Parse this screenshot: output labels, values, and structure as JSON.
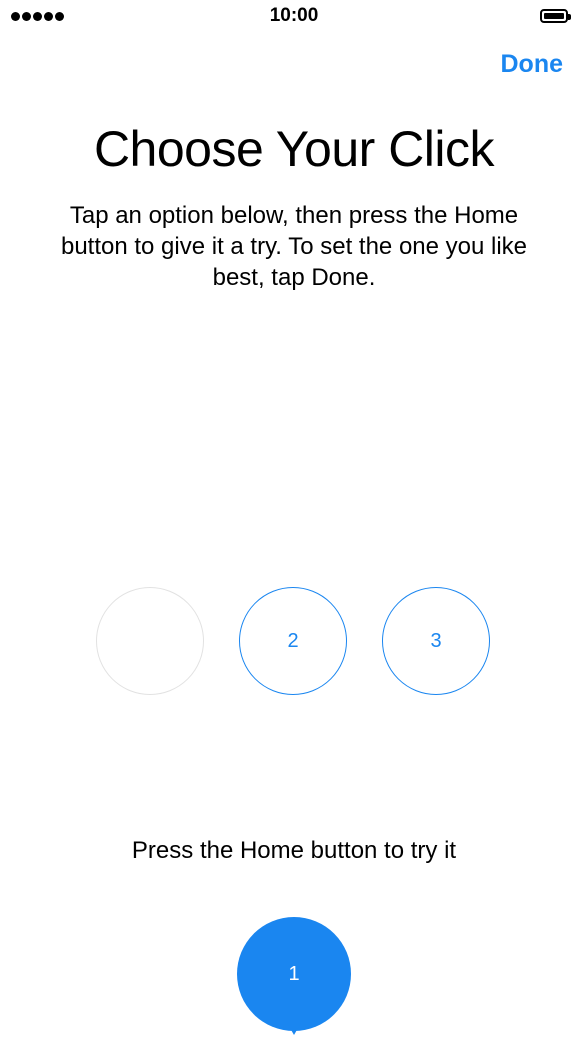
{
  "status_bar": {
    "time": "10:00",
    "signal_icon": "signal-dots-icon",
    "battery_icon": "battery-full-icon"
  },
  "nav": {
    "done_label": "Done"
  },
  "title": "Choose Your Click",
  "instructions": "Tap an option below, then press the Home button to give it a try. To set the one you like best, tap Done.",
  "options": [
    {
      "label": ""
    },
    {
      "label": "2"
    },
    {
      "label": "3"
    }
  ],
  "hint": "Press the Home button to try it",
  "selected_option": {
    "label": "1"
  },
  "colors": {
    "accent": "#1a86f0",
    "inactive_border": "#e2e2e2"
  }
}
